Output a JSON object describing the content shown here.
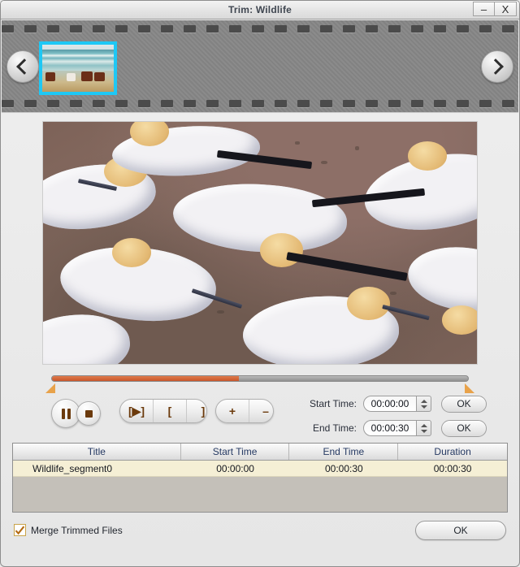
{
  "window": {
    "title": "Trim: Wildlife",
    "minimize_label": "–",
    "close_label": "X"
  },
  "filmstrip": {
    "prev_icon": "chevron-left-icon",
    "next_icon": "chevron-right-icon",
    "selected_thumbnail": "horses-on-beach-thumbnail"
  },
  "preview": {
    "description": "gannet-colony-frame"
  },
  "scrubber": {
    "progress_percent": 45,
    "in_marker": "trim-in-marker",
    "out_marker": "trim-out-marker"
  },
  "transport": {
    "pause_icon": "pause-icon",
    "stop_icon": "stop-icon",
    "play_segment_label": "[▶]",
    "mark_in_label": "[",
    "mark_out_label": "]",
    "add_label": "+",
    "remove_label": "–"
  },
  "time_controls": {
    "start_label": "Start Time:",
    "start_value": "00:00:00",
    "end_label": "End Time:",
    "end_value": "00:00:30",
    "start_ok_label": "OK",
    "end_ok_label": "OK"
  },
  "segments_table": {
    "columns": [
      "Title",
      "Start Time",
      "End Time",
      "Duration"
    ],
    "rows": [
      {
        "title": "Wildlife_segment0",
        "start_time": "00:00:00",
        "end_time": "00:00:30",
        "duration": "00:00:30"
      }
    ]
  },
  "footer": {
    "merge_label": "Merge Trimmed Files",
    "merge_checked": true,
    "ok_label": "OK"
  },
  "colors": {
    "selection_border": "#1ec8f5",
    "progress_fill": "#cd5f33",
    "marker": "#e8a24a",
    "row_highlight": "#f5efd5",
    "icon_brown": "#6b3a0c"
  }
}
